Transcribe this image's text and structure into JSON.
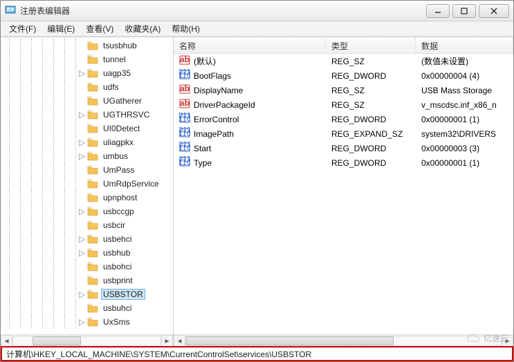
{
  "window": {
    "title": "注册表编辑器"
  },
  "menu": {
    "file": "文件(F)",
    "edit": "编辑(E)",
    "view": "查看(V)",
    "favorites": "收藏夹(A)",
    "help": "帮助(H)"
  },
  "tree": {
    "items": [
      {
        "label": "tsusbhub",
        "expand": "leaf"
      },
      {
        "label": "tunnel",
        "expand": "leaf"
      },
      {
        "label": "uagp35",
        "expand": "closed"
      },
      {
        "label": "udfs",
        "expand": "leaf"
      },
      {
        "label": "UGatherer",
        "expand": "leaf"
      },
      {
        "label": "UGTHRSVC",
        "expand": "closed"
      },
      {
        "label": "UI0Detect",
        "expand": "leaf"
      },
      {
        "label": "uliagpkx",
        "expand": "closed"
      },
      {
        "label": "umbus",
        "expand": "closed"
      },
      {
        "label": "UmPass",
        "expand": "leaf"
      },
      {
        "label": "UmRdpService",
        "expand": "leaf"
      },
      {
        "label": "upnphost",
        "expand": "leaf"
      },
      {
        "label": "usbccgp",
        "expand": "closed"
      },
      {
        "label": "usbcir",
        "expand": "leaf"
      },
      {
        "label": "usbehci",
        "expand": "closed"
      },
      {
        "label": "usbhub",
        "expand": "closed"
      },
      {
        "label": "usbohci",
        "expand": "leaf"
      },
      {
        "label": "usbprint",
        "expand": "leaf"
      },
      {
        "label": "USBSTOR",
        "expand": "closed",
        "selected": true
      },
      {
        "label": "usbuhci",
        "expand": "leaf"
      },
      {
        "label": "UxSms",
        "expand": "closed"
      }
    ]
  },
  "columns": {
    "name": "名称",
    "type": "类型",
    "data": "数据"
  },
  "values": [
    {
      "icon": "ab",
      "name": "(默认)",
      "type": "REG_SZ",
      "data": "(数值未设置)"
    },
    {
      "icon": "bin",
      "name": "BootFlags",
      "type": "REG_DWORD",
      "data": "0x00000004 (4)"
    },
    {
      "icon": "ab",
      "name": "DisplayName",
      "type": "REG_SZ",
      "data": "USB Mass Storage"
    },
    {
      "icon": "ab",
      "name": "DriverPackageId",
      "type": "REG_SZ",
      "data": "v_mscdsc.inf_x86_n"
    },
    {
      "icon": "bin",
      "name": "ErrorControl",
      "type": "REG_DWORD",
      "data": "0x00000001 (1)"
    },
    {
      "icon": "bin",
      "name": "ImagePath",
      "type": "REG_EXPAND_SZ",
      "data": "system32\\DRIVERS"
    },
    {
      "icon": "bin",
      "name": "Start",
      "type": "REG_DWORD",
      "data": "0x00000003 (3)"
    },
    {
      "icon": "bin",
      "name": "Type",
      "type": "REG_DWORD",
      "data": "0x00000001 (1)"
    }
  ],
  "statusbar": {
    "path": "计算机\\HKEY_LOCAL_MACHINE\\SYSTEM\\CurrentControlSet\\services\\USBSTOR"
  },
  "watermark": {
    "text": "亿速云"
  }
}
